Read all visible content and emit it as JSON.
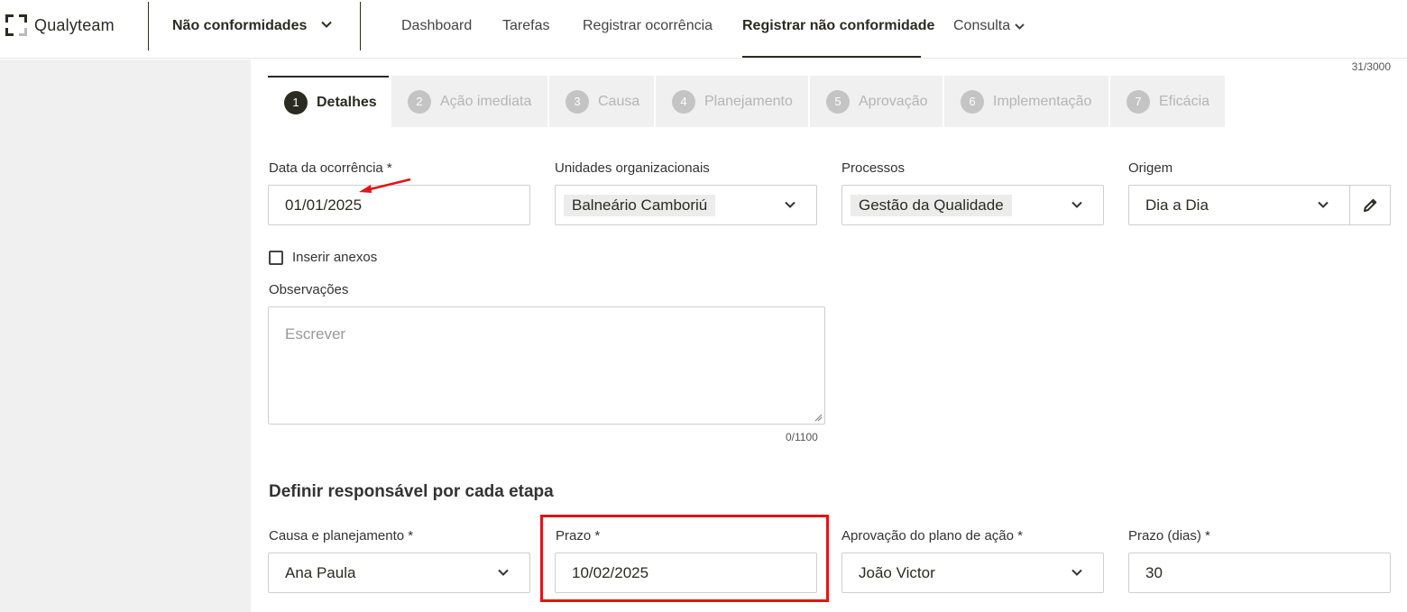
{
  "app": {
    "logo_text": "Qualyteam",
    "module": "Não conformidades"
  },
  "nav": [
    {
      "label": "Dashboard"
    },
    {
      "label": "Tarefas"
    },
    {
      "label": "Registrar ocorrência"
    },
    {
      "label": "Registrar não conformidade",
      "active": true
    },
    {
      "label": "Consulta"
    }
  ],
  "top_counter": "31/3000",
  "steps": [
    {
      "num": "1",
      "label": "Detalhes",
      "active": true
    },
    {
      "num": "2",
      "label": "Ação imediata"
    },
    {
      "num": "3",
      "label": "Causa"
    },
    {
      "num": "4",
      "label": "Planejamento"
    },
    {
      "num": "5",
      "label": "Aprovação"
    },
    {
      "num": "6",
      "label": "Implementação"
    },
    {
      "num": "7",
      "label": "Eficácia"
    }
  ],
  "form": {
    "data_label": "Data da ocorrência *",
    "data_value": "01/01/2025",
    "unidades_label": "Unidades organizacionais",
    "unidades_value": "Balneário Camboriú",
    "processos_label": "Processos",
    "processos_value": "Gestão da Qualidade",
    "origem_label": "Origem",
    "origem_value": "Dia a Dia",
    "anexos_label": "Inserir anexos",
    "obs_label": "Observações",
    "obs_placeholder": "Escrever",
    "obs_counter": "0/1100"
  },
  "responsaveis": {
    "title": "Definir responsável por cada etapa",
    "causa_label": "Causa e planejamento *",
    "causa_value": "Ana Paula",
    "prazo_label": "Prazo *",
    "prazo_value": "10/02/2025",
    "aprovacao_label": "Aprovação do plano de ação *",
    "aprovacao_value": "João Victor",
    "prazo_dias_label": "Prazo (dias) *",
    "prazo_dias_value": "30"
  },
  "colors": {
    "primary": "#2b2b22",
    "highlight": "#e21515",
    "arrow": "#e21515"
  }
}
